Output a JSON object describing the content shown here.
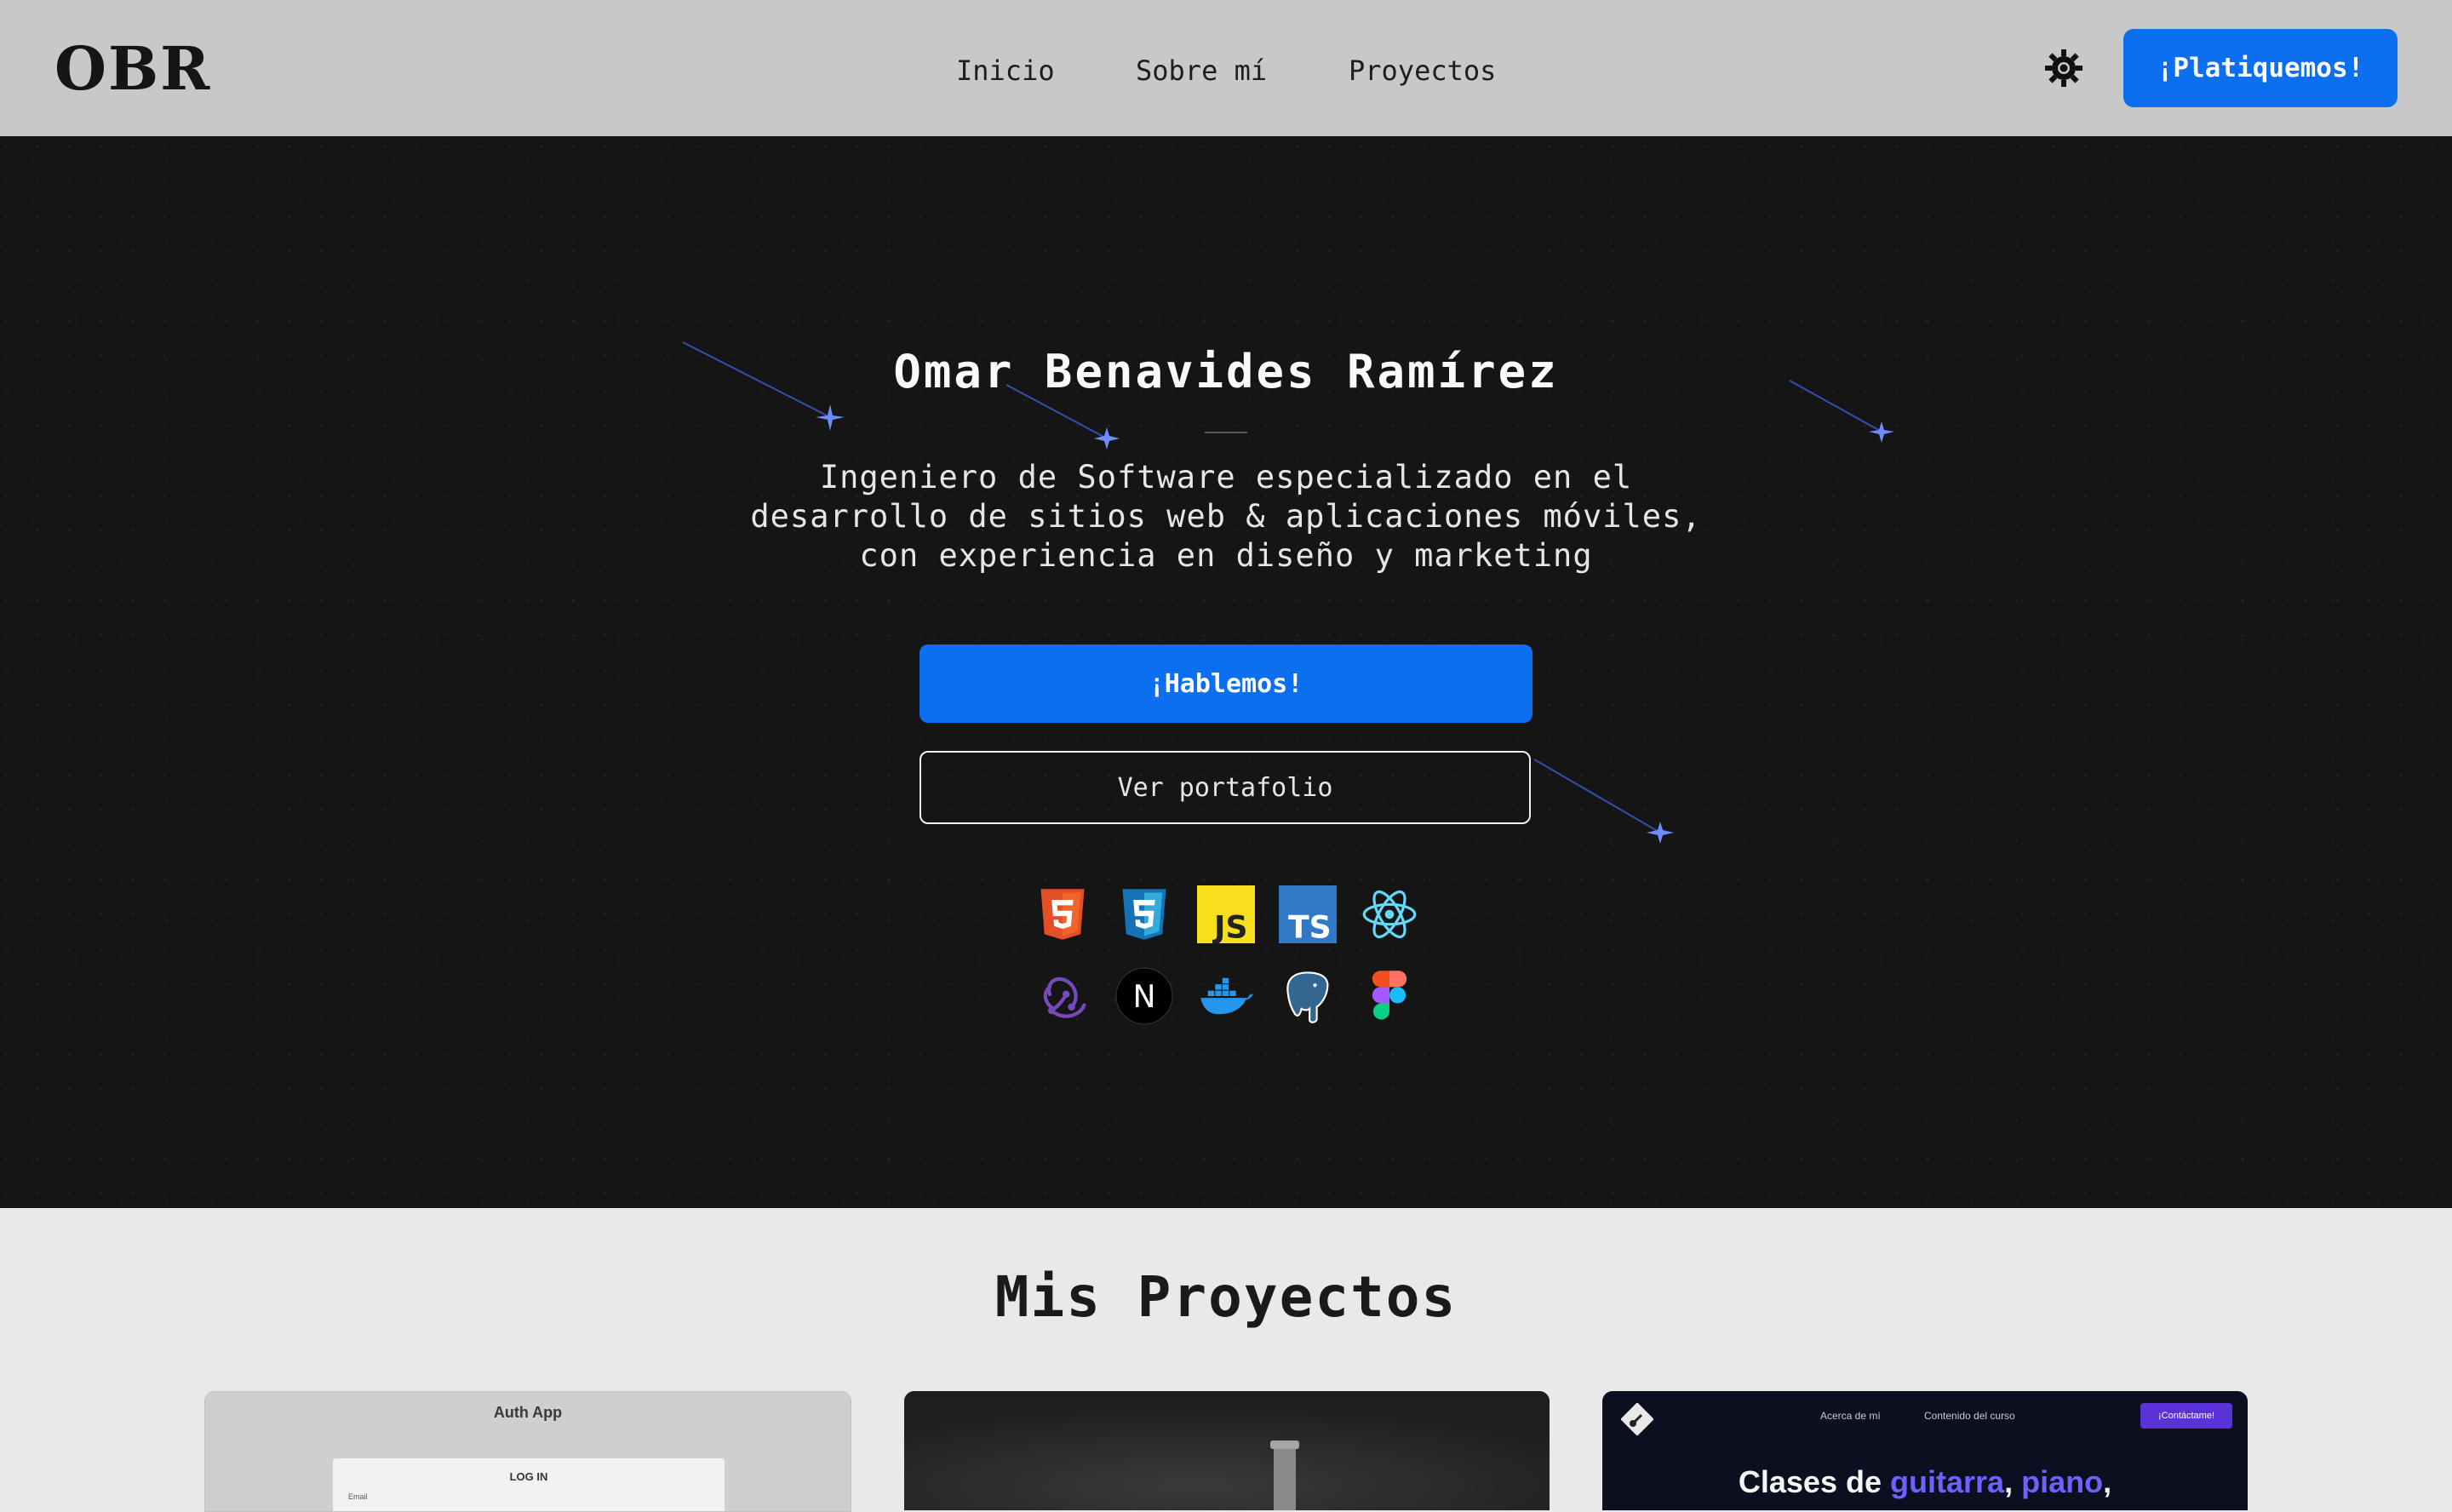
{
  "header": {
    "logo": "OBR",
    "nav": [
      {
        "label": "Inicio"
      },
      {
        "label": "Sobre mí"
      },
      {
        "label": "Proyectos"
      }
    ],
    "theme_icon": "sun-gear-icon",
    "cta_label": "¡Platiquemos!"
  },
  "hero": {
    "title": "Omar Benavides Ramírez",
    "description": "Ingeniero de Software especializado en el desarrollo de sitios web & aplicaciones móviles, con experiencia en diseño y marketing",
    "primary_button": "¡Hablemos!",
    "secondary_button": "Ver portafolio",
    "tech_icons": [
      "html5-icon",
      "css3-icon",
      "javascript-icon",
      "typescript-icon",
      "react-icon",
      "redux-icon",
      "nextjs-icon",
      "docker-icon",
      "postgresql-icon",
      "figma-icon"
    ],
    "tech_text": {
      "js": "JS",
      "ts": "TS",
      "next": "N"
    }
  },
  "projects": {
    "title": "Mis Proyectos",
    "card1": {
      "title": "Auth App",
      "login": "LOG IN",
      "email_label": "Email"
    },
    "card3": {
      "nav1": "Acerca de mí",
      "nav2": "Contenido del curso",
      "button": "¡Contáctame!",
      "heading_prefix": "Clases de",
      "heading_accent1": "guitarra",
      "heading_sep": ",",
      "heading_accent2": "piano",
      "heading_suffix": ","
    }
  },
  "colors": {
    "accent": "#0b6ff0",
    "header_bg": "#c8c8c8",
    "hero_bg": "#151515",
    "section_bg": "#e9e9e9"
  }
}
